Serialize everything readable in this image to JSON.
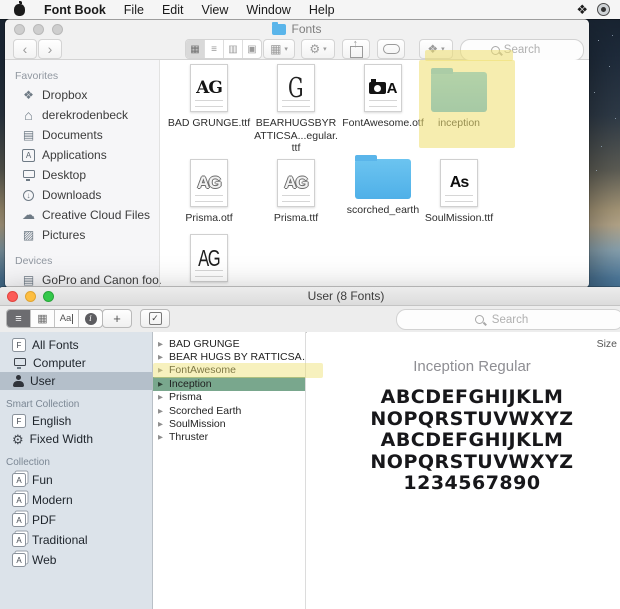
{
  "icons": {
    "disclosure": "▶",
    "chevron_down": "▾",
    "back": "‹",
    "forward": "›",
    "view_grid": "▦",
    "view_list": "≡",
    "view_columns": "▥",
    "view_coverflow": "▣",
    "gear": "⚙",
    "dropbox": "❖",
    "plus": "+",
    "check": "✓",
    "info": "i",
    "sample_label": "Aa",
    "eject": "⏏",
    "home": "⌂",
    "documents": "▤",
    "cloud": "☁",
    "pictures": "▨",
    "down_arrow": "↓",
    "letter_f": "F",
    "letter_a": "A"
  },
  "menu_bar": {
    "app": "Font Book",
    "items": [
      "File",
      "Edit",
      "View",
      "Window",
      "Help"
    ]
  },
  "finder": {
    "title": "Fonts",
    "search_placeholder": "Search",
    "sidebar": {
      "favorites_header": "Favorites",
      "favorites": [
        "Dropbox",
        "derekrodenbeck",
        "Documents",
        "Applications",
        "Desktop",
        "Downloads",
        "Creative Cloud Files",
        "Pictures"
      ],
      "devices_header": "Devices",
      "devices": [
        "GoPro and Canon foo…"
      ]
    },
    "files": [
      {
        "label": "BAD GRUNGE.ttf",
        "glyph": "AG"
      },
      {
        "label": "BEARHUGSBYRATTICSA...egular.ttf",
        "glyph": "G"
      },
      {
        "label": "FontAwesome.otf",
        "glyph": "A"
      },
      {
        "label": "inception"
      },
      {
        "label": "Prisma.otf",
        "glyph": "AG"
      },
      {
        "label": "Prisma.ttf",
        "glyph": "AG"
      },
      {
        "label": "scorched_earth"
      },
      {
        "label": "SoulMission.ttf",
        "glyph": "As"
      },
      {
        "label": "",
        "glyph": "AG"
      }
    ]
  },
  "fontbook": {
    "title": "User (8 Fonts)",
    "search_placeholder": "Search",
    "sidebar": {
      "library_items": [
        "All Fonts",
        "Computer",
        "User"
      ],
      "smart_header": "Smart Collection",
      "smart_items": [
        "English",
        "Fixed Width"
      ],
      "collection_header": "Collection",
      "collection_items": [
        "Fun",
        "Modern",
        "PDF",
        "Traditional",
        "Web"
      ]
    },
    "font_list": [
      "BAD GRUNGE",
      "BEAR HUGS BY RATTICSA…",
      "FontAwesome",
      "Inception",
      "Prisma",
      "Scorched Earth",
      "SoulMission",
      "Thruster"
    ],
    "selected_font": "Inception",
    "preview": {
      "size_label": "Size",
      "title": "Inception Regular",
      "line1": "ABCDEFGHIJKLM",
      "line2": "NOPQRSTUVWXYZ",
      "line3": "ABCDEFGHIJKLM",
      "line4": "NOPQRSTUVWXYZ",
      "line5": "1234567890"
    }
  }
}
